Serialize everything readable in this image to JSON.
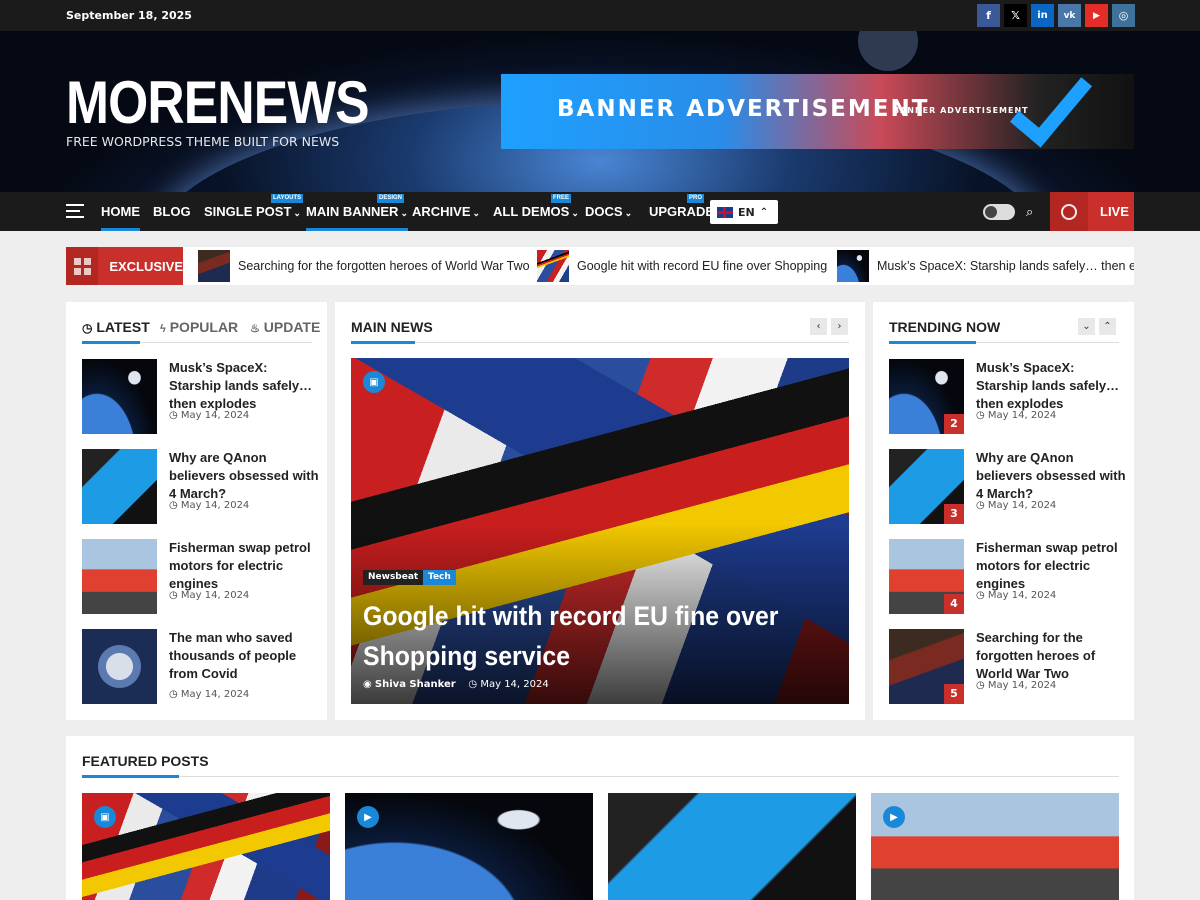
{
  "topbar": {
    "date": "September 18, 2025"
  },
  "social": [
    {
      "name": "facebook",
      "glyph": "f",
      "color": "#3b5998"
    },
    {
      "name": "x",
      "glyph": "𝕏",
      "color": "#000000"
    },
    {
      "name": "linkedin",
      "glyph": "in",
      "color": "#0a66c2"
    },
    {
      "name": "vk",
      "glyph": "vk",
      "color": "#4a76a8"
    },
    {
      "name": "youtube",
      "glyph": "▶",
      "color": "#e52d27"
    },
    {
      "name": "instagram",
      "glyph": "◎",
      "color": "#3f729b"
    }
  ],
  "header": {
    "logo": "MORENEWS",
    "tagline": "FREE WORDPRESS THEME BUILT FOR NEWS",
    "banner_big": "BANNER ADVERTISEMENT",
    "banner_small": "BANNER ADVERTISEMENT"
  },
  "nav": {
    "items": [
      {
        "label": "HOME",
        "active": true
      },
      {
        "label": "BLOG"
      },
      {
        "label": "SINGLE POST",
        "caret": true,
        "badge": "LAYOUTS"
      },
      {
        "label": "MAIN BANNER",
        "caret": true,
        "badge": "DESIGN",
        "active": true
      },
      {
        "label": "ARCHIVE",
        "caret": true
      },
      {
        "label": "ALL DEMOS",
        "caret": true,
        "badge": "FREE"
      },
      {
        "label": "DOCS",
        "caret": true
      },
      {
        "label": "UPGRADE",
        "badge": "PRO"
      }
    ],
    "lang": "EN",
    "live": "LIVE"
  },
  "ticker": {
    "label": "EXCLUSIVE",
    "items": [
      "Searching for the forgotten heroes of World War Two",
      "Google hit with record EU fine over Shopping",
      "Musk’s SpaceX: Starship lands safely… then explodes"
    ]
  },
  "left_panel": {
    "tabs": [
      "LATEST",
      "POPULAR",
      "UPDATE"
    ],
    "posts": [
      {
        "title": "Musk’s SpaceX: Starship lands safely… then explodes",
        "date": "May 14, 2024"
      },
      {
        "title": "Why are QAnon believers obsessed with 4 March?",
        "date": "May 14, 2024"
      },
      {
        "title": "Fisherman swap petrol motors for electric engines",
        "date": "May 14, 2024"
      },
      {
        "title": "The man who saved thousands of people from Covid",
        "date": "May 14, 2024"
      }
    ]
  },
  "main_news": {
    "title": "MAIN NEWS",
    "categories": [
      "Newsbeat",
      "Tech"
    ],
    "headline": "Google hit with record EU fine over Shopping service",
    "author": "Shiva Shanker",
    "date": "May 14, 2024"
  },
  "trending": {
    "title": "TRENDING NOW",
    "posts": [
      {
        "rank": "2",
        "title": "Musk’s SpaceX: Starship lands safely… then explodes",
        "date": "May 14, 2024"
      },
      {
        "rank": "3",
        "title": "Why are QAnon believers obsessed with 4 March?",
        "date": "May 14, 2024"
      },
      {
        "rank": "4",
        "title": "Fisherman swap petrol motors for electric engines",
        "date": "May 14, 2024"
      },
      {
        "rank": "5",
        "title": "Searching for the forgotten heroes of World War Two",
        "date": "May 14, 2024"
      }
    ]
  },
  "featured": {
    "title": "FEATURED POSTS"
  },
  "colors": {
    "accent": "#1a88d8",
    "live": "#c9302c",
    "dark": "#1b1b1b"
  }
}
